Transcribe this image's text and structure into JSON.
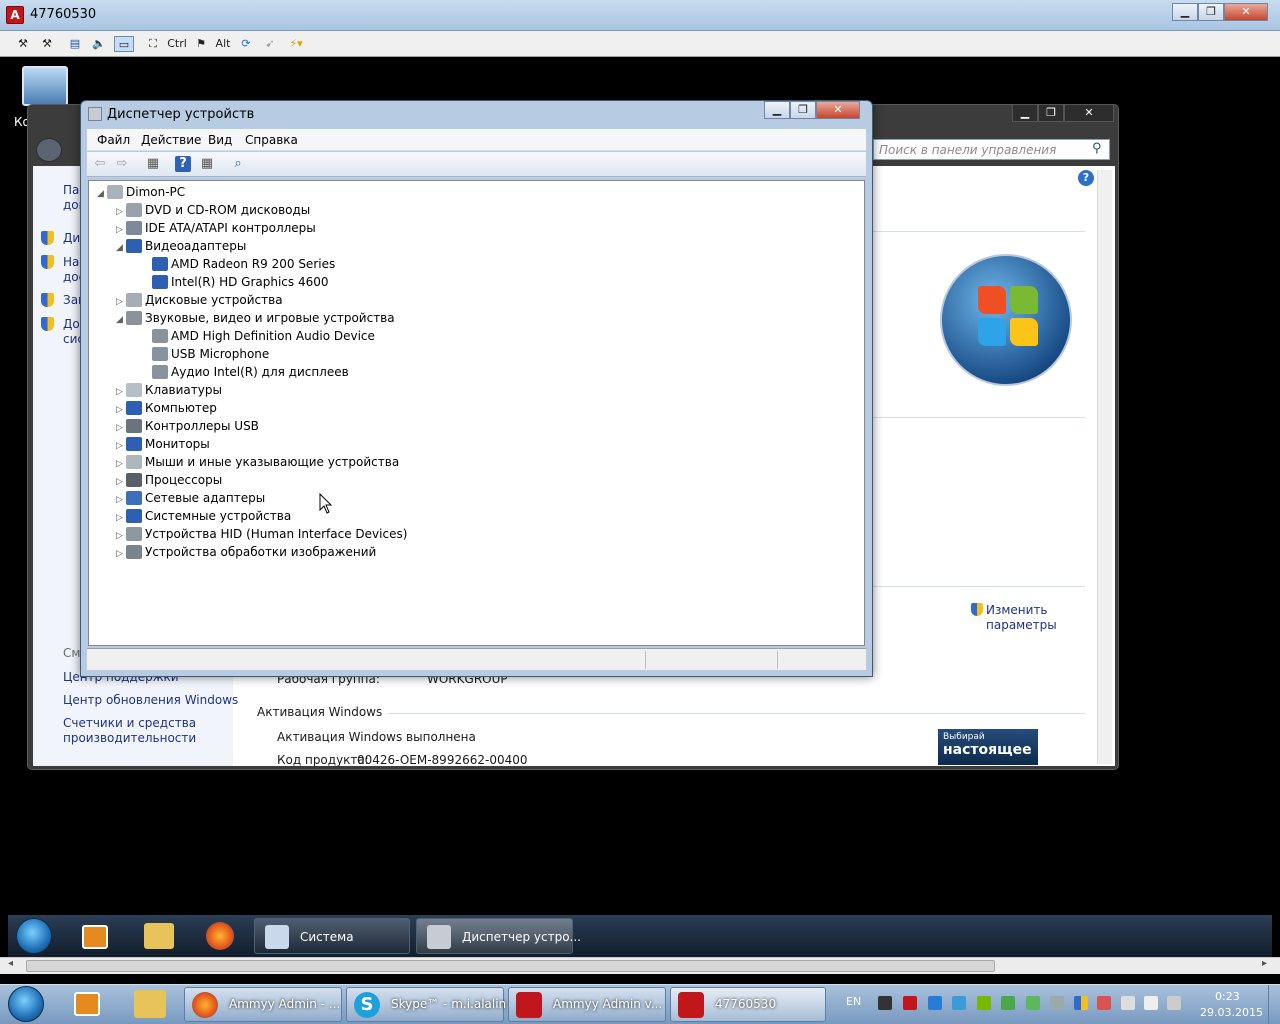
{
  "ammyy": {
    "title": "47760530",
    "toolbar_ctrl": "Ctrl",
    "toolbar_alt": "Alt"
  },
  "system_window": {
    "search_placeholder": "Поиск в панели управления",
    "left_partial": [
      "Па",
      "дом",
      "Ди",
      "На",
      "дос",
      "Защ",
      "До",
      "сис"
    ],
    "see_also": "См",
    "links": [
      "Центр поддержки",
      "Центр обновления Windows",
      "Счетчики и средства",
      "производительности"
    ],
    "workgroup_label": "Рабочая группа:",
    "workgroup_value": "WORKGROUP",
    "activation_heading": "Активация Windows",
    "activation_status": "Активация Windows выполнена",
    "product_code_label": "Код продукта:",
    "product_code": "00426-OEM-8992662-00400",
    "change_link": [
      "Изменить",
      "параметры"
    ],
    "banner_line1": "Выбирай",
    "banner_line2": "настоящее"
  },
  "device_manager": {
    "title": "Диспетчер устройств",
    "menu": [
      "Файл",
      "Действие",
      "Вид",
      "Справка"
    ],
    "root": "Dimon-PC",
    "tree": [
      {
        "label": "DVD и CD-ROM дисководы",
        "level": 1,
        "expanded": false,
        "icon": "dvd-drive-icon"
      },
      {
        "label": "IDE ATA/ATAPI контроллеры",
        "level": 1,
        "expanded": false,
        "icon": "ide-controller-icon"
      },
      {
        "label": "Видеоадаптеры",
        "level": 1,
        "expanded": true,
        "icon": "display-adapter-icon"
      },
      {
        "label": "AMD Radeon R9 200 Series",
        "level": 2,
        "icon": "display-adapter-icon"
      },
      {
        "label": "Intel(R) HD Graphics 4600",
        "level": 2,
        "icon": "display-adapter-icon"
      },
      {
        "label": "Дисковые устройства",
        "level": 1,
        "expanded": false,
        "icon": "disk-drive-icon"
      },
      {
        "label": "Звуковые, видео и игровые устройства",
        "level": 1,
        "expanded": true,
        "icon": "speaker-icon"
      },
      {
        "label": "AMD High Definition Audio Device",
        "level": 2,
        "icon": "speaker-icon"
      },
      {
        "label": "USB Microphone",
        "level": 2,
        "icon": "speaker-icon"
      },
      {
        "label": "Аудио Intel(R) для дисплеев",
        "level": 2,
        "icon": "speaker-icon"
      },
      {
        "label": "Клавиатуры",
        "level": 1,
        "expanded": false,
        "icon": "keyboard-icon"
      },
      {
        "label": "Компьютер",
        "level": 1,
        "expanded": false,
        "icon": "computer-icon"
      },
      {
        "label": "Контроллеры USB",
        "level": 1,
        "expanded": false,
        "icon": "usb-icon"
      },
      {
        "label": "Мониторы",
        "level": 1,
        "expanded": false,
        "icon": "monitor-icon"
      },
      {
        "label": "Мыши и иные указывающие устройства",
        "level": 1,
        "expanded": false,
        "icon": "mouse-icon"
      },
      {
        "label": "Процессоры",
        "level": 1,
        "expanded": false,
        "icon": "processor-icon"
      },
      {
        "label": "Сетевые адаптеры",
        "level": 1,
        "expanded": false,
        "icon": "network-adapter-icon"
      },
      {
        "label": "Системные устройства",
        "level": 1,
        "expanded": false,
        "icon": "system-device-icon"
      },
      {
        "label": "Устройства HID (Human Interface Devices)",
        "level": 1,
        "expanded": false,
        "icon": "hid-icon"
      },
      {
        "label": "Устройства обработки изображений",
        "level": 1,
        "expanded": false,
        "icon": "camera-icon"
      }
    ]
  },
  "remote_taskbar": {
    "items": [
      "Система",
      "Диспетчер устро..."
    ]
  },
  "taskbar": {
    "items": [
      "Ammyy Admin - ...",
      "Skype™ - m.i.alalin",
      "Ammyy Admin v...",
      "47760530"
    ],
    "lang": "EN",
    "time": "0:23",
    "date": "29.03.2015"
  }
}
